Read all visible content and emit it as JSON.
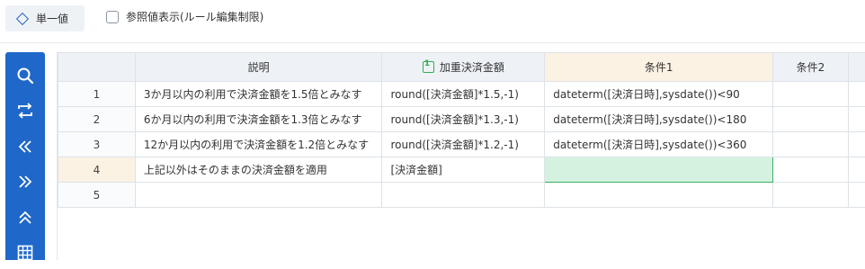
{
  "toolbar": {
    "mode_button_label": "単一値",
    "reference_checkbox_label": "参照値表示(ルール編集制限)",
    "reference_checked": false
  },
  "sidebar": {
    "icons": [
      "search-icon",
      "swap-icon",
      "collapse-left-icon",
      "expand-right-icon",
      "collapse-up-icon",
      "grid-icon"
    ]
  },
  "grid": {
    "headers": {
      "description": "説明",
      "weighted_amount": "加重決済金額",
      "weighted_amount_icon": "1",
      "condition1": "条件1",
      "condition2": "条件2"
    },
    "rows": [
      {
        "num": "1",
        "description": "3か月以内の利用で決済金額を1.5倍とみなす",
        "weighted_amount": "round([決済金額]*1.5,-1)",
        "condition1": "dateterm([決済日時],sysdate())<90",
        "condition2": ""
      },
      {
        "num": "2",
        "description": "6か月以内の利用で決済金額を1.3倍とみなす",
        "weighted_amount": "round([決済金額]*1.3,-1)",
        "condition1": "dateterm([決済日時],sysdate())<180",
        "condition2": ""
      },
      {
        "num": "3",
        "description": "12か月以内の利用で決済金額を1.2倍とみなす",
        "weighted_amount": "round([決済金額]*1.2,-1)",
        "condition1": "dateterm([決済日時],sysdate())<360",
        "condition2": ""
      },
      {
        "num": "4",
        "description": "上記以外はそのままの決済金額を適用",
        "weighted_amount": "[決済金額]",
        "condition1": "",
        "condition2": ""
      },
      {
        "num": "5",
        "description": "",
        "weighted_amount": "",
        "condition1": "",
        "condition2": ""
      }
    ]
  },
  "colors": {
    "accent": "#1f68c9",
    "selected_cell_fill": "#d5f2e0",
    "selected_cell_border": "#3cae66",
    "highlight_header": "#fbf2e3"
  }
}
